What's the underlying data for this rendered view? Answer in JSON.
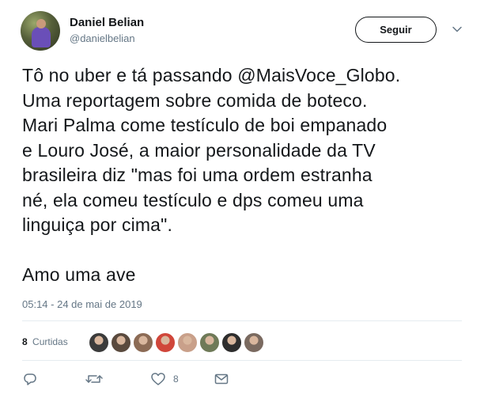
{
  "author": {
    "display_name": "Daniel Belian",
    "screen_name": "@danielbelian"
  },
  "follow_button": {
    "label": "Seguir"
  },
  "tweet": {
    "text": "Tô no uber e tá passando @MaisVoce_Globo.\nUma reportagem sobre comida de boteco.\nMari Palma come testículo de boi empanado\ne Louro José, a maior personalidade da TV\nbrasileira diz \"mas foi uma ordem estranha\nné, ela comeu testículo e dps comeu uma\nlinguiça por cima\".\n\nAmo uma ave",
    "timestamp": "05:14 - 24 de mai de 2019"
  },
  "stats": {
    "likes_count": "8",
    "likes_label": "Curtidas",
    "liker_avatar_colors": [
      "#3b3b3b",
      "#5a4a3e",
      "#8c6b55",
      "#d0463a",
      "#c9a08a",
      "#6f7a58",
      "#2e2e2e",
      "#7a6a60"
    ]
  },
  "actions": {
    "like_count": "8"
  },
  "icons": {
    "reply": "reply-icon",
    "retweet": "retweet-icon",
    "like": "heart-icon",
    "message": "envelope-icon",
    "more": "chevron-down-icon"
  }
}
